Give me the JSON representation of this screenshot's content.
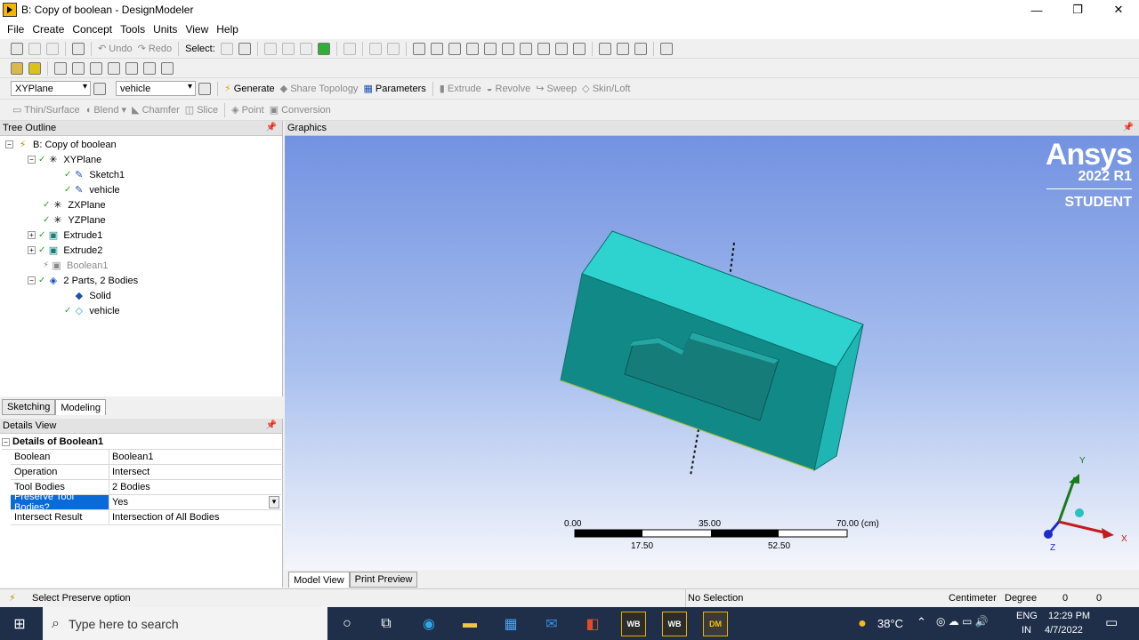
{
  "window": {
    "title": "B: Copy of boolean - DesignModeler"
  },
  "menu": [
    "File",
    "Create",
    "Concept",
    "Tools",
    "Units",
    "View",
    "Help"
  ],
  "toolbar1": {
    "undo": "Undo",
    "redo": "Redo",
    "select": "Select:"
  },
  "toolbar3": {
    "plane": "XYPlane",
    "sketch": "vehicle",
    "generate": "Generate",
    "share_topology": "Share Topology",
    "parameters": "Parameters",
    "extrude": "Extrude",
    "revolve": "Revolve",
    "sweep": "Sweep",
    "skin_loft": "Skin/Loft"
  },
  "toolbar4": {
    "thin_surface": "Thin/Surface",
    "blend": "Blend",
    "chamfer": "Chamfer",
    "slice": "Slice",
    "point": "Point",
    "conversion": "Conversion"
  },
  "tree": {
    "header": "Tree Outline",
    "nodes": [
      {
        "label": "B: Copy of boolean"
      },
      {
        "label": "XYPlane"
      },
      {
        "label": "Sketch1"
      },
      {
        "label": "vehicle"
      },
      {
        "label": "ZXPlane"
      },
      {
        "label": "YZPlane"
      },
      {
        "label": "Extrude1"
      },
      {
        "label": "Extrude2"
      },
      {
        "label": "Boolean1"
      },
      {
        "label": "2 Parts, 2 Bodies"
      },
      {
        "label": "Solid"
      },
      {
        "label": "vehicle"
      }
    ]
  },
  "tabs_left": [
    "Sketching",
    "Modeling"
  ],
  "details": {
    "header": "Details View",
    "section": "Details of Boolean1",
    "rows": [
      {
        "k": "Boolean",
        "v": "Boolean1"
      },
      {
        "k": "Operation",
        "v": "Intersect"
      },
      {
        "k": "Tool Bodies",
        "v": "2 Bodies"
      },
      {
        "k": "Preserve Tool Bodies?",
        "v": "Yes"
      },
      {
        "k": "Intersect Result",
        "v": "Intersection of All Bodies"
      }
    ]
  },
  "graphics": {
    "header": "Graphics",
    "brand": {
      "name": "Ansys",
      "version": "2022 R1",
      "edition": "STUDENT"
    },
    "scale": {
      "top": [
        "0.00",
        "35.00",
        "70.00 (cm)"
      ],
      "bottom": [
        "17.50",
        "52.50"
      ]
    },
    "axes": {
      "x": "X",
      "y": "Y",
      "z": "Z"
    },
    "colors": {
      "body_top": "#2ed3d0",
      "body_front": "#118a87",
      "body_side": "#1fb5b2"
    }
  },
  "tabs_bottom": [
    "Model View",
    "Print Preview"
  ],
  "status": {
    "message": "Select Preserve option",
    "selection": "No Selection",
    "units": "Centimeter",
    "angle": "Degree",
    "v1": "0",
    "v2": "0"
  },
  "taskbar": {
    "search": "Type here to search",
    "temp": "38°C",
    "lang1": "ENG",
    "lang2": "IN",
    "time": "12:29 PM",
    "date": "4/7/2022",
    "wb1": "WB",
    "wb2": "WB",
    "dm": "DM"
  }
}
